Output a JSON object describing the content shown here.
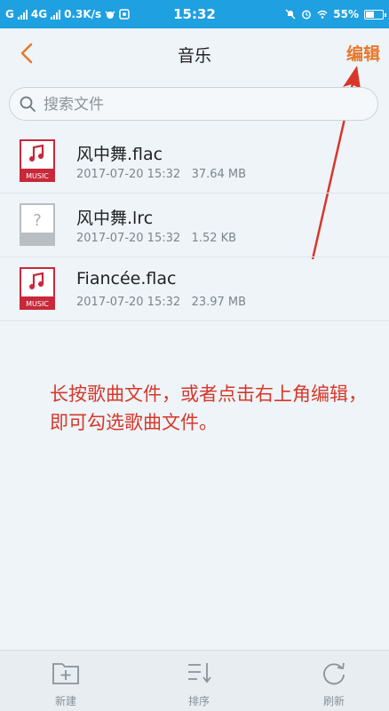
{
  "status_bar": {
    "carrier_left": "G",
    "network": "4G",
    "speed": "0.3K/s",
    "time": "15:32",
    "battery": "55%",
    "battery_level": 0.55
  },
  "header": {
    "title": "音乐",
    "edit_label": "编辑"
  },
  "search": {
    "placeholder": "搜索文件"
  },
  "files": [
    {
      "name": "风中舞.flac",
      "date": "2017-07-20 15:32",
      "size": "37.64 MB",
      "icon": "music-file-icon",
      "icon_label": "MUSIC"
    },
    {
      "name": "风中舞.lrc",
      "date": "2017-07-20 15:32",
      "size": "1.52 KB",
      "icon": "unknown-file-icon",
      "icon_label": "?"
    },
    {
      "name": "Fiancée.flac",
      "date": "2017-07-20 15:32",
      "size": "23.97 MB",
      "icon": "music-file-icon",
      "icon_label": "MUSIC"
    }
  ],
  "annotation": {
    "text": "长按歌曲文件，或者点击右上角编辑，即可勾选歌曲文件。"
  },
  "toolbar": {
    "new_label": "新建",
    "sort_label": "排序",
    "refresh_label": "刷新"
  },
  "colors": {
    "status_bar": "#1fa0e0",
    "accent": "#e9772a",
    "music_red": "#c8283a",
    "annotation_red": "#d7372a"
  }
}
